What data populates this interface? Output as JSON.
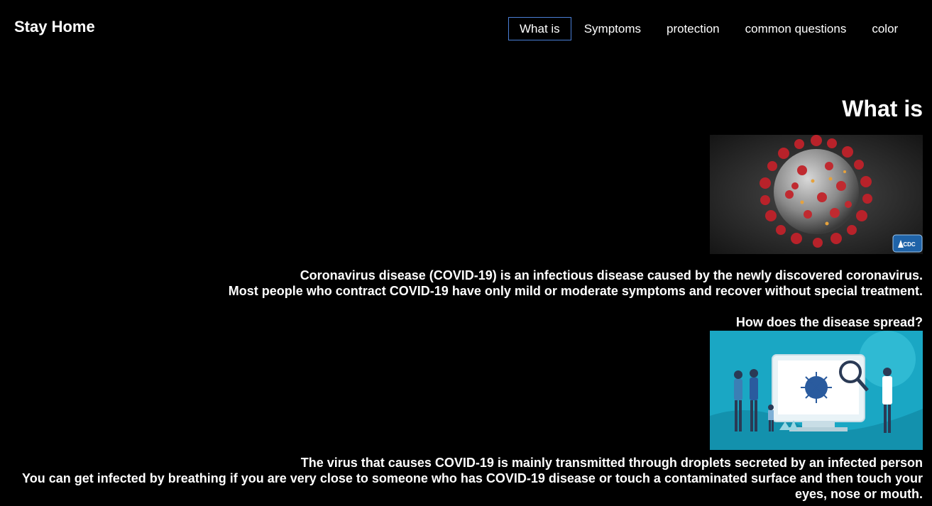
{
  "header": {
    "brand": "Stay Home",
    "nav": [
      {
        "label": "What is",
        "active": true
      },
      {
        "label": "Symptoms",
        "active": false
      },
      {
        "label": "protection",
        "active": false
      },
      {
        "label": "common questions",
        "active": false
      },
      {
        "label": "color",
        "active": false
      }
    ],
    "nav_active_border_color": "#4a7fd6"
  },
  "main": {
    "title": "What is",
    "image1": {
      "icon": "coronavirus-illustration",
      "badge": "CDC"
    },
    "paragraph1": [
      "Coronavirus disease (COVID-19) is an infectious disease caused by the newly discovered coronavirus.",
      "Most people who contract COVID-19 have only mild or moderate symptoms and recover without special treatment."
    ],
    "subtitle": "How does the disease spread?",
    "image2": {
      "icon": "disease-spread-illustration"
    },
    "paragraph2": [
      "The virus that causes COVID-19 is mainly transmitted through droplets secreted by an infected person",
      "You can get infected by breathing if you are very close to someone who has COVID-19 disease or touch a contaminated surface and then touch your eyes, nose or mouth."
    ]
  },
  "colors": {
    "background": "#000000",
    "text": "#ffffff",
    "accent": "#4a7fd6"
  }
}
